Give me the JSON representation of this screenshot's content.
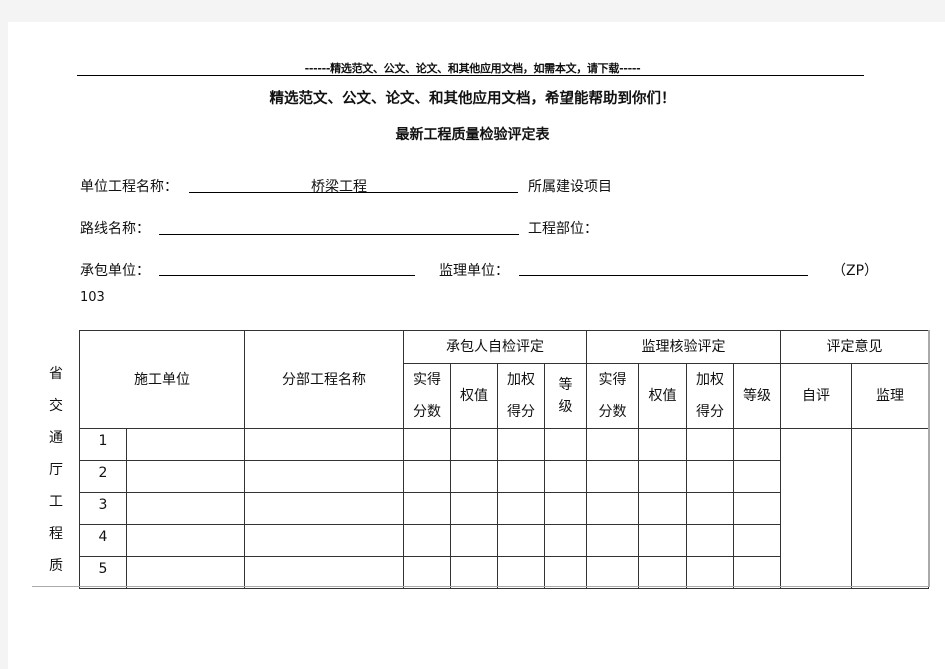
{
  "header": {
    "download_banner": "------精选范文、公文、论文、和其他应用文档，如需本文，请下载-----",
    "slogan": "精选范文、公文、论文、和其他应用文档，希望能帮助到你们！",
    "title": "最新工程质量检验评定表"
  },
  "form": {
    "unit_project_label": "单位工程名称：",
    "unit_project_value": "桥梁工程",
    "belongs_project_label": "所属建设项目",
    "route_name_label": "路线名称：",
    "route_name_value": "",
    "project_part_label": "工程部位：",
    "contractor_label": "承包单位：",
    "contractor_value": "",
    "supervisor_label": "监理单位：",
    "supervisor_value": "",
    "form_code": "（ZP）",
    "form_number": "103"
  },
  "side_label": [
    "省",
    "交",
    "通",
    "厅",
    "工",
    "程",
    "质"
  ],
  "table": {
    "headers": {
      "construction_unit": "施工单位",
      "sub_project_name": "分部工程名称",
      "contractor_self_check": "承包人自检评定",
      "supervisor_check": "监理核验评定",
      "evaluation_opinion": "评定意见",
      "actual_score_1": "实得",
      "actual_score_2": "分数",
      "weight": "权值",
      "weighted_1": "加权",
      "weighted_2": "得分",
      "grade_1": "等",
      "grade_2": "级",
      "grade": "等级",
      "self_eval": "自评",
      "supervision": "监理"
    },
    "rows": [
      {
        "no": "1",
        "unit": "",
        "name": ""
      },
      {
        "no": "2",
        "unit": "",
        "name": ""
      },
      {
        "no": "3",
        "unit": "",
        "name": ""
      },
      {
        "no": "4",
        "unit": "",
        "name": ""
      },
      {
        "no": "5",
        "unit": "",
        "name": ""
      }
    ]
  }
}
